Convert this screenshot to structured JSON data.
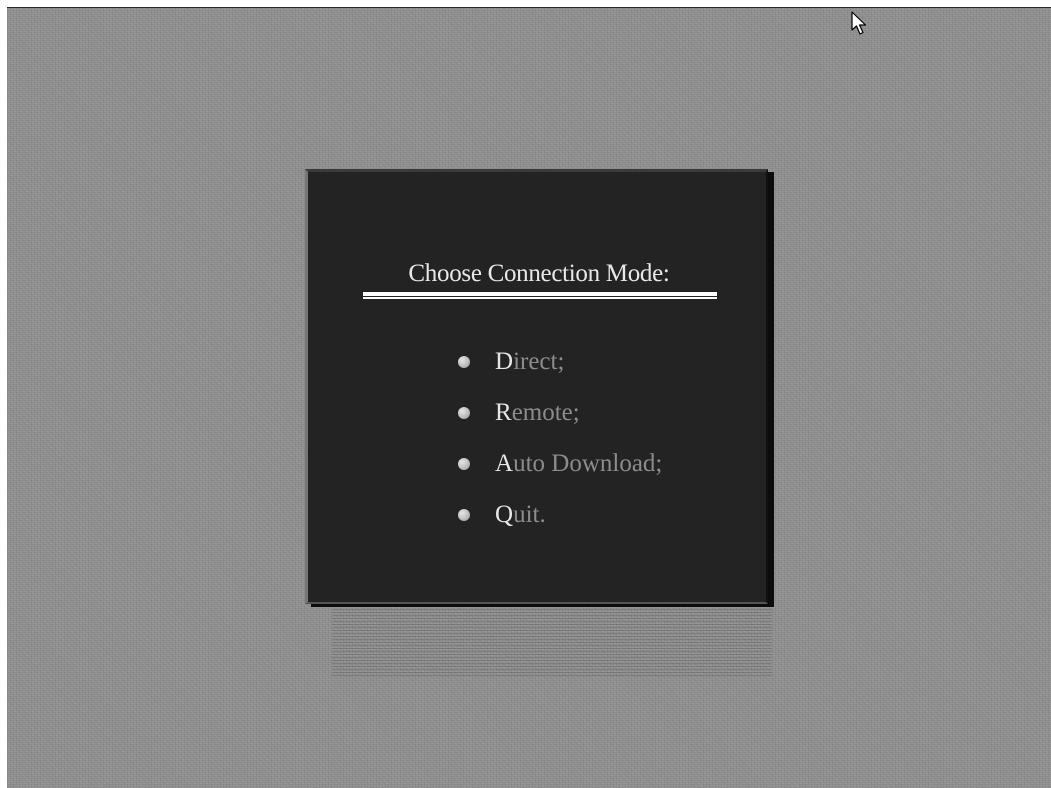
{
  "dialog": {
    "title": "Choose Connection Mode:"
  },
  "menu": {
    "items": [
      {
        "initial": "D",
        "rest": "irect;"
      },
      {
        "initial": "R",
        "rest": "emote;"
      },
      {
        "initial": "A",
        "rest": "uto Download;"
      },
      {
        "initial": "Q",
        "rest": "uit."
      }
    ]
  },
  "colors": {
    "background": "#8c8c8c",
    "panel": "#232323",
    "title_text": "#e8e8e8",
    "menu_text": "#8c8c8c",
    "menu_initial": "#e6e6e6",
    "bullet": "#bdbdbd"
  },
  "icons": {
    "cursor": "arrow-cursor-icon",
    "bullet": "bullet-icon"
  }
}
